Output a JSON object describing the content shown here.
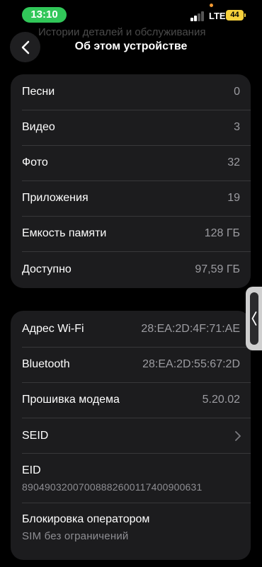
{
  "status_bar": {
    "time": "13:10",
    "network": "LTE",
    "battery": "44"
  },
  "background_text": "Истории деталей и обслуживания",
  "header": {
    "title": "Об этом устройстве"
  },
  "media_section": [
    {
      "label": "Песни",
      "value": "0"
    },
    {
      "label": "Видео",
      "value": "3"
    },
    {
      "label": "Фото",
      "value": "32"
    },
    {
      "label": "Приложения",
      "value": "19"
    },
    {
      "label": "Емкость памяти",
      "value": "128 ГБ"
    },
    {
      "label": "Доступно",
      "value": "97,59 ГБ"
    }
  ],
  "network_section": {
    "wifi": {
      "label": "Адрес Wi-Fi",
      "value": "28:EA:2D:4F:71:AE"
    },
    "bluetooth": {
      "label": "Bluetooth",
      "value": "28:EA:2D:55:67:2D"
    },
    "modem": {
      "label": "Прошивка модема",
      "value": "5.20.02"
    },
    "seid": {
      "label": "SEID"
    },
    "eid": {
      "label": "EID",
      "value": "89049032007008882600117400900631"
    },
    "carrier_lock": {
      "label": "Блокировка оператором",
      "value": "SIM без ограничений"
    }
  },
  "icons": {
    "back": "chevron-left-icon",
    "seid_disclosure": "chevron-right-icon",
    "edge_handle": "chevron-left-icon"
  },
  "colors": {
    "time_pill": "#31c759",
    "battery": "#f7d13c",
    "card": "#1c1c1e",
    "secondary_text": "#9c9ca1"
  }
}
